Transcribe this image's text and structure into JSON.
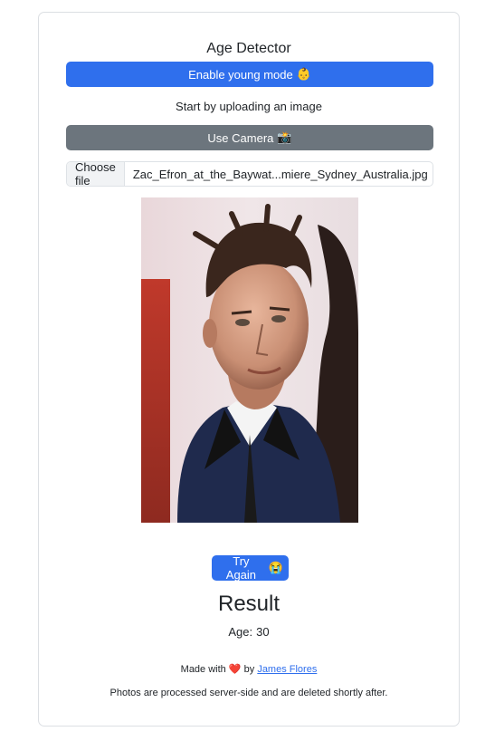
{
  "app": {
    "title": "Age Detector"
  },
  "buttons": {
    "young_mode": "Enable young mode",
    "young_mode_emoji": "👶",
    "camera": "Use Camera",
    "camera_emoji": "📸",
    "try_again": "Try Again",
    "try_again_emoji": "😭"
  },
  "hint": "Start by uploading an image",
  "file_input": {
    "button_label": "Choose file",
    "file_name": "Zac_Efron_at_the_Baywat...miere_Sydney_Australia.jpg"
  },
  "result": {
    "heading": "Result",
    "age_label": "Age:",
    "age_value": "30"
  },
  "footer": {
    "made_with": "Made with",
    "heart": "❤️",
    "by": "by",
    "author": "James Flores",
    "privacy": "Photos are processed server-side and are deleted shortly after."
  },
  "colors": {
    "primary": "#2f6fed",
    "secondary": "#6c757d"
  },
  "icons": {
    "young_mode": "baby-emoji",
    "camera": "camera-emoji",
    "try_again": "crying-face-emoji",
    "heart": "heart-emoji"
  }
}
